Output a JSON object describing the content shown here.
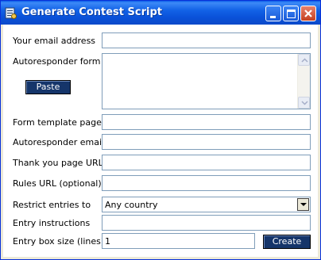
{
  "window": {
    "title": "Generate Contest Script",
    "buttons": {
      "minimize": "minimize",
      "maximize": "maximize",
      "close": "close"
    }
  },
  "form": {
    "email_label": "Your email address",
    "email_value": "",
    "autoresponder_form_label": "Autoresponder form",
    "autoresponder_form_value": "",
    "paste_label": "Paste",
    "template_label": "Form template page",
    "template_value": "",
    "autoresponder_email_label": "Autoresponder email",
    "autoresponder_email_value": "",
    "thankyou_label": "Thank you page URL",
    "thankyou_value": "",
    "rules_label": "Rules URL (optional)",
    "rules_value": "",
    "restrict_label": "Restrict entries to",
    "restrict_value": "Any country",
    "instructions_label": "Entry instructions",
    "instructions_value": "",
    "boxsize_label": "Entry box size (lines)",
    "boxsize_value": "1",
    "create_label": "Create"
  }
}
